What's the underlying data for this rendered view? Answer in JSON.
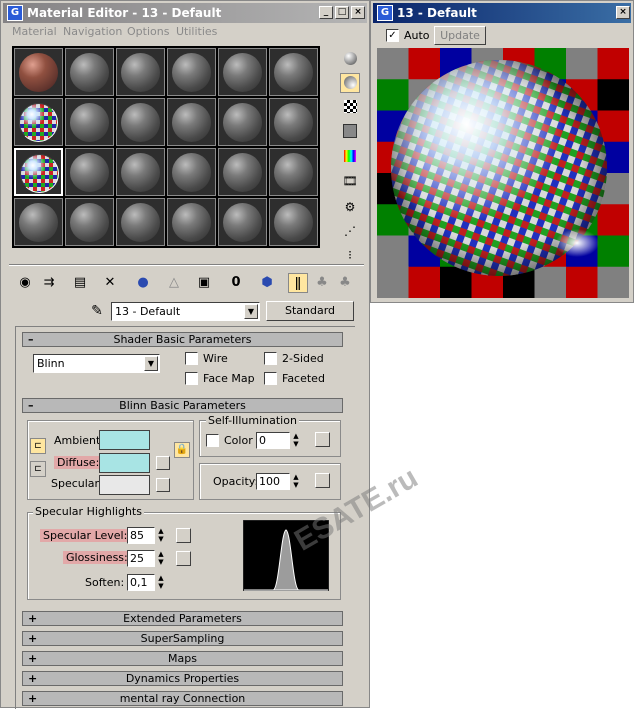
{
  "editor": {
    "title": "Material Editor - 13 - Default",
    "menu": [
      "Material",
      "Navigation",
      "Options",
      "Utilities"
    ],
    "material_name": "13 - Default",
    "material_type": "Standard"
  },
  "preview": {
    "title": "13 - Default",
    "auto_label": "Auto",
    "update_label": "Update",
    "checker_colors": [
      "#c00000",
      "#008000",
      "#0000a0",
      "#808080",
      "#000000"
    ]
  },
  "shader_basic": {
    "header": "Shader Basic Parameters",
    "shader": "Blinn",
    "wire": "Wire",
    "two_sided": "2-Sided",
    "face_map": "Face Map",
    "faceted": "Faceted"
  },
  "blinn_basic": {
    "header": "Blinn Basic Parameters",
    "ambient": "Ambient:",
    "diffuse": "Diffuse:",
    "specular": "Specular:",
    "ambient_color": "#a8e4e4",
    "diffuse_color": "#a8e4e4",
    "specular_color": "#e8e8e8",
    "self_illum_label": "Self-Illumination",
    "color_label": "Color",
    "color_value": "0",
    "opacity_label": "Opacity:",
    "opacity_value": "100"
  },
  "spec_highlights": {
    "label": "Specular Highlights",
    "level_label": "Specular Level:",
    "level_value": "85",
    "gloss_label": "Glossiness:",
    "gloss_value": "25",
    "soften_label": "Soften:",
    "soften_value": "0,1"
  },
  "rollouts": [
    {
      "sign": "+",
      "label": "Extended Parameters"
    },
    {
      "sign": "+",
      "label": "SuperSampling"
    },
    {
      "sign": "+",
      "label": "Maps"
    },
    {
      "sign": "+",
      "label": "Dynamics Properties"
    },
    {
      "sign": "+",
      "label": "mental ray Connection"
    }
  ],
  "watermark": "ESATE.ru"
}
